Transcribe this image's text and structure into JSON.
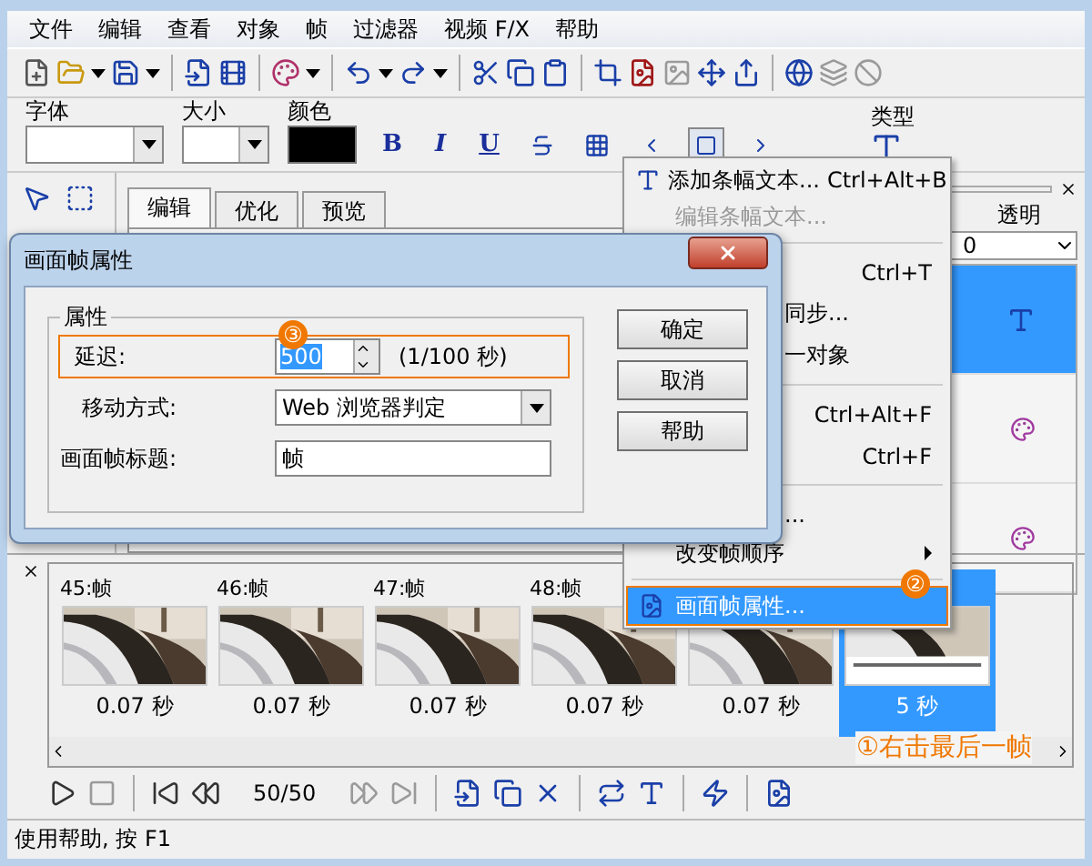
{
  "menu_bar": [
    "文件",
    "编辑",
    "查看",
    "对象",
    "帧",
    "过滤器",
    "视频 F/X",
    "帮助"
  ],
  "text_toolbar": {
    "font_label": "字体",
    "size_label": "大小",
    "color_label": "颜色",
    "type_label": "类型",
    "styles": [
      "B",
      "I",
      "U"
    ],
    "align": [
      {
        "selected": false
      },
      {
        "selected": true
      },
      {
        "selected": false
      }
    ]
  },
  "editor_tabs": [
    {
      "label": "编辑",
      "selected": true
    },
    {
      "label": "优化",
      "selected": false
    },
    {
      "label": "预览",
      "selected": false
    }
  ],
  "right_panel": {
    "label": "透明",
    "value": "0",
    "items": [
      {
        "selected": true
      },
      {
        "selected": false
      },
      {
        "selected": false
      }
    ]
  },
  "frames": [
    {
      "label": "45:帧",
      "duration": "0.07 秒",
      "selected": false
    },
    {
      "label": "46:帧",
      "duration": "0.07 秒",
      "selected": false
    },
    {
      "label": "47:帧",
      "duration": "0.07 秒",
      "selected": false
    },
    {
      "label": "48:帧",
      "duration": "0.07 秒",
      "selected": false
    },
    {
      "duration": "0.07 秒",
      "selected": false
    },
    {
      "duration": "5 秒",
      "selected": true
    }
  ],
  "frame_annotation": "①右击最后一帧",
  "player": {
    "counter": "50/50"
  },
  "status_bar": "使用帮助, 按 F1",
  "context_menu": [
    {
      "kind": "item",
      "label": "添加条幅文本...",
      "shortcut": "Ctrl+Alt+B",
      "disabled": false,
      "selected": false
    },
    {
      "kind": "item",
      "label": "编辑条幅文本...",
      "disabled": true,
      "selected": false
    },
    {
      "kind": "separator"
    },
    {
      "kind": "partial",
      "shortcut": "Ctrl+T",
      "selected": false
    },
    {
      "kind": "partial",
      "label": "同步...",
      "selected": false
    },
    {
      "kind": "partial",
      "label": "一对象",
      "selected": false
    },
    {
      "kind": "separator"
    },
    {
      "kind": "partial",
      "shortcut": "Ctrl+Alt+F",
      "selected": false
    },
    {
      "kind": "partial",
      "shortcut": "Ctrl+F",
      "selected": false
    },
    {
      "kind": "separator"
    },
    {
      "kind": "partial",
      "label": "...",
      "selected": false
    },
    {
      "kind": "item",
      "label": "改变帧顺序",
      "submenu": true,
      "disabled": false,
      "selected": false
    },
    {
      "kind": "separator"
    },
    {
      "kind": "item",
      "label": "画面帧属性...",
      "badge": "②",
      "disabled": false,
      "selected": true
    }
  ],
  "dialog": {
    "title": "画面帧属性",
    "group": "属性",
    "badge": "③",
    "delay": {
      "label": "延迟:",
      "value": "500",
      "unit": "(1/100 秒)"
    },
    "move": {
      "label": "移动方式:",
      "value": "Web 浏览器判定"
    },
    "frame_title": {
      "label": "画面帧标题:",
      "value": "帧"
    },
    "buttons": [
      "确定",
      "取消",
      "帮助"
    ]
  }
}
